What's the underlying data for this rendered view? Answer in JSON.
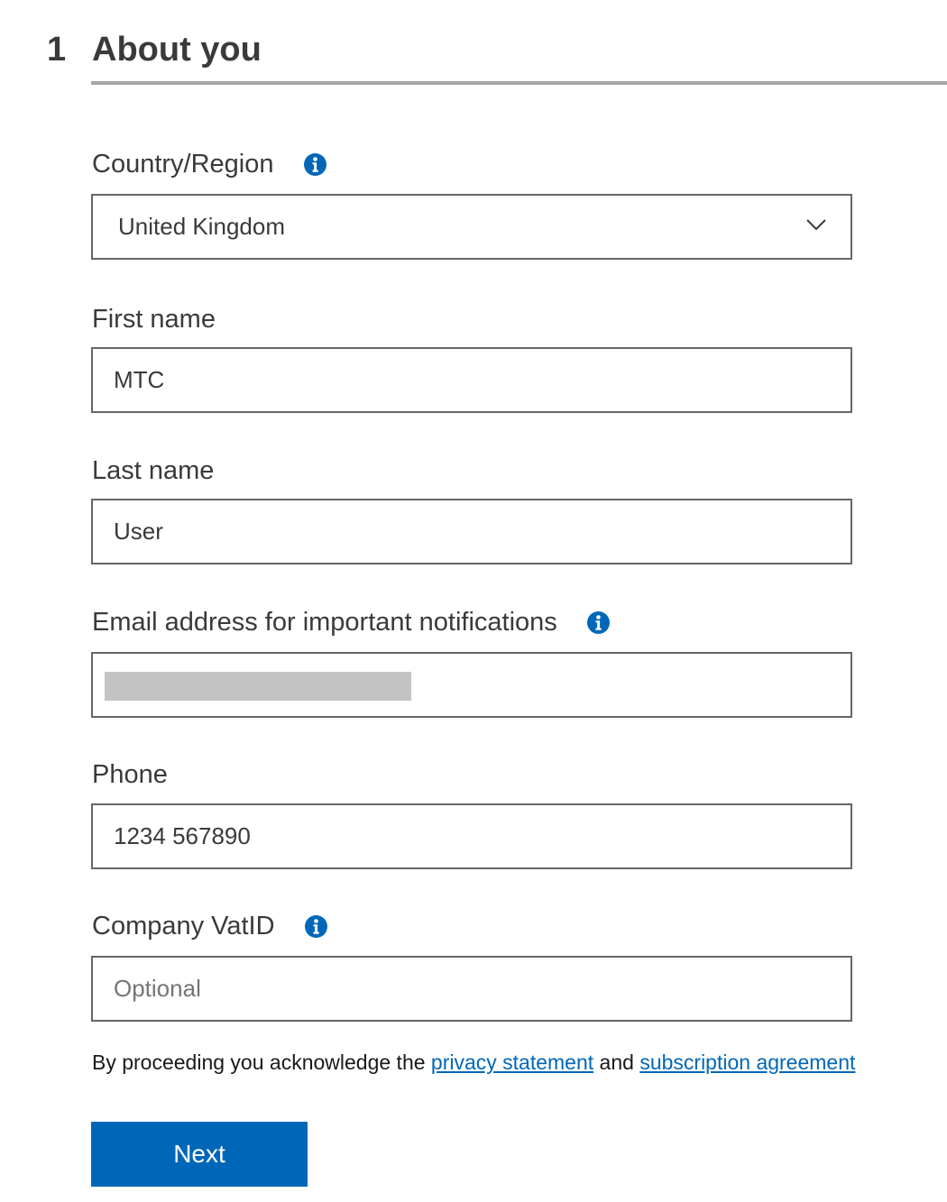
{
  "step": {
    "number": "1",
    "title": "About you"
  },
  "fields": {
    "country": {
      "label": "Country/Region",
      "value": "United Kingdom",
      "info_icon": "info-icon"
    },
    "first_name": {
      "label": "First name",
      "value": "MTC"
    },
    "last_name": {
      "label": "Last name",
      "value": "User"
    },
    "email": {
      "label": "Email address for important notifications",
      "value": "",
      "redacted": true,
      "info_icon": "info-icon"
    },
    "phone": {
      "label": "Phone",
      "value": "1234 567890"
    },
    "vat": {
      "label": "Company VatID",
      "value": "",
      "placeholder": "Optional",
      "info_icon": "info-icon"
    }
  },
  "consent": {
    "prefix": "By proceeding you acknowledge the ",
    "privacy_link": "privacy statement",
    "middle": " and ",
    "subscription_link": "subscription agreement"
  },
  "actions": {
    "next_label": "Next"
  },
  "colors": {
    "accent": "#0067b8",
    "text": "#3b3a39",
    "border": "#666666",
    "rule": "#a6a6a6",
    "redaction": "#c3c3c3"
  }
}
